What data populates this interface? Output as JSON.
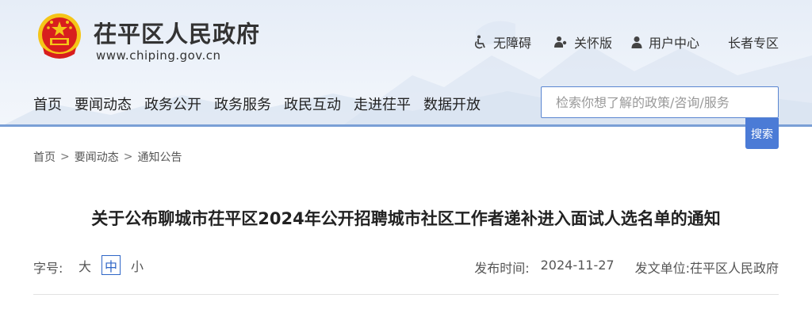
{
  "header": {
    "site_title": "茌平区人民政府",
    "site_url": "www.chiping.gov.cn",
    "util_links": [
      {
        "label": "无障碍",
        "icon": "wheelchair-icon"
      },
      {
        "label": "关怀版",
        "icon": "care-person-icon"
      },
      {
        "label": "用户中心",
        "icon": "user-icon"
      },
      {
        "label": "长者专区",
        "icon": ""
      }
    ]
  },
  "nav": {
    "items": [
      "首页",
      "要闻动态",
      "政务公开",
      "政务服务",
      "政民互动",
      "走进茌平",
      "数据开放"
    ]
  },
  "search": {
    "placeholder": "检索你想了解的政策/咨询/服务",
    "button_label": "搜索"
  },
  "breadcrumb": {
    "items": [
      "首页",
      "要闻动态",
      "通知公告"
    ],
    "separator": ">"
  },
  "article": {
    "title": "关于公布聊城市茌平区2024年公开招聘城市社区工作者递补进入面试人选名单的通知",
    "font_size_label": "字号:",
    "font_sizes": [
      "大",
      "中",
      "小"
    ],
    "selected_font_size": "中",
    "publish_time_label": "发布时间:",
    "publish_time": "2024-11-27",
    "issuer_label": "发文单位:",
    "issuer": "茌平区人民政府"
  },
  "colors": {
    "accent": "#4b7bd6",
    "header_bg": "#e6edf7",
    "emblem_red": "#d81e1e",
    "emblem_gold": "#f5c518"
  }
}
